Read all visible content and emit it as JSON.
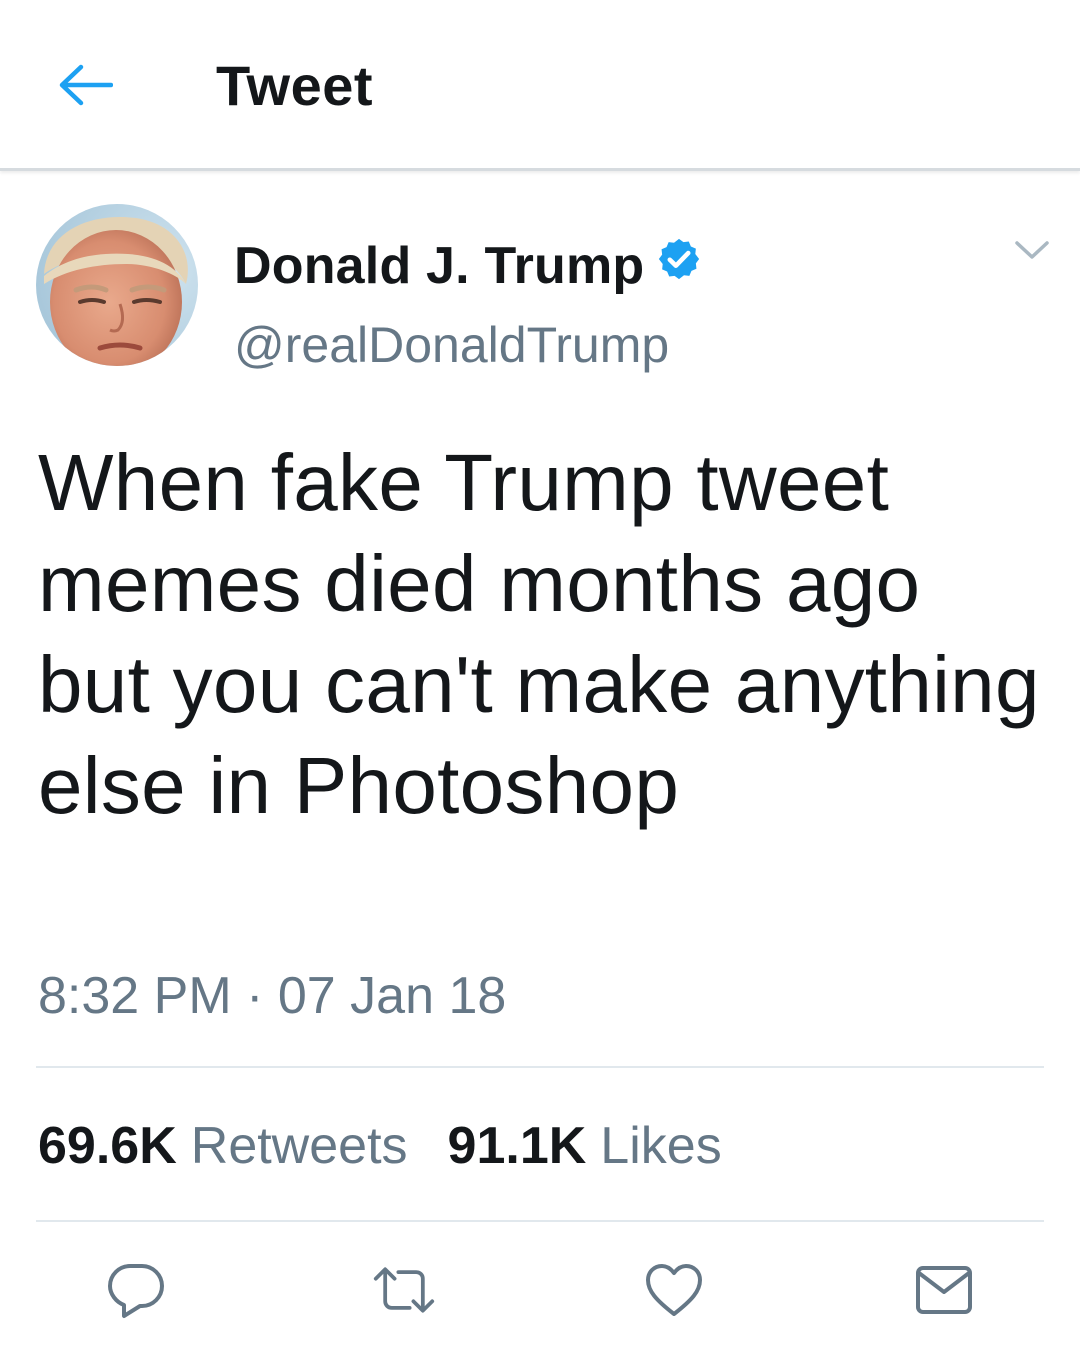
{
  "header": {
    "title": "Tweet",
    "back_icon": "arrow-left-icon",
    "accent_color": "#1da1f2"
  },
  "tweet": {
    "author": {
      "display_name": "Donald J. Trump",
      "handle": "@realDonaldTrump",
      "verified": true,
      "verified_color": "#1da1f2"
    },
    "text": "When fake Trump tweet memes died months ago but you can't make anything else in Photoshop",
    "timestamp": "8:32 PM · 07 Jan 18",
    "stats": {
      "retweets_count": "69.6K",
      "retweets_label": "Retweets",
      "likes_count": "91.1K",
      "likes_label": "Likes"
    },
    "actions": [
      "reply-icon",
      "retweet-icon",
      "like-icon",
      "share-message-icon"
    ]
  },
  "colors": {
    "text_primary": "#14171a",
    "text_secondary": "#657786",
    "divider": "#e1e8ed"
  }
}
